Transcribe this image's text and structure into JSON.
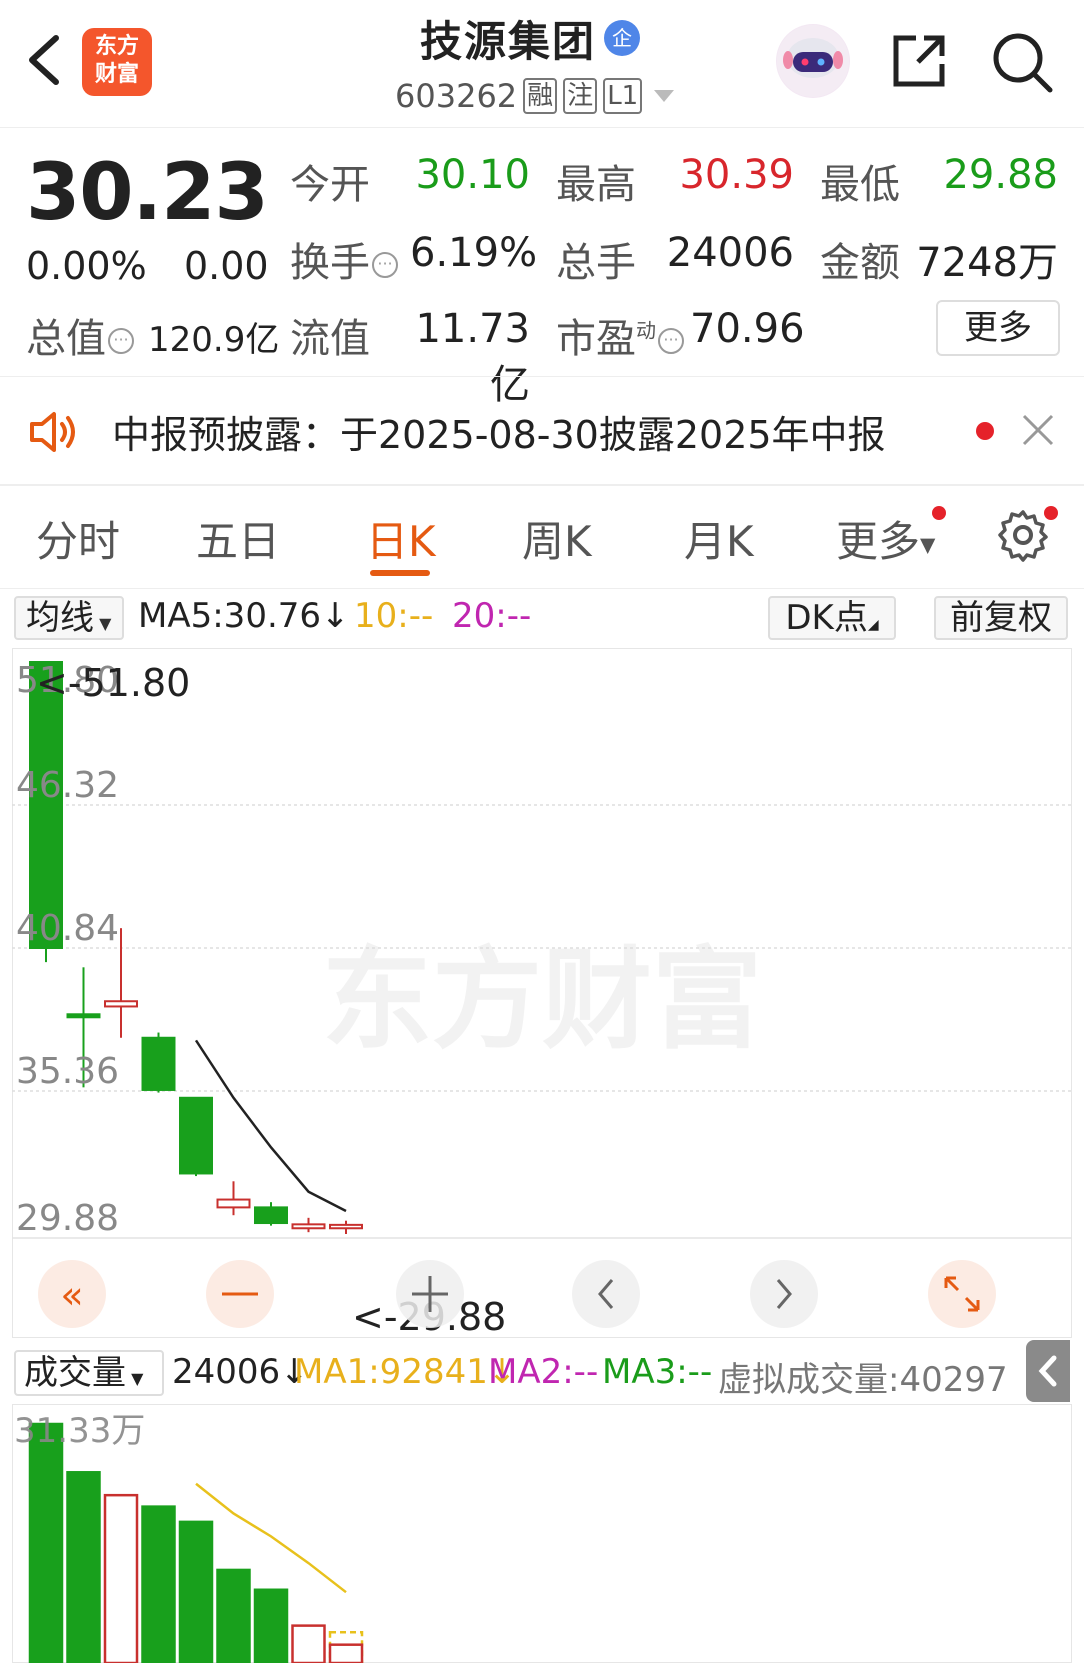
{
  "header": {
    "logo_line1": "东方",
    "logo_line2": "财富",
    "stock_name": "技源集团",
    "badge": "企",
    "stock_code": "603262",
    "tags": [
      "融",
      "注",
      "L1"
    ]
  },
  "quote": {
    "price": "30.23",
    "change_pct": "0.00%",
    "change": "0.00",
    "rows": [
      [
        {
          "label": "今开",
          "value": "30.10",
          "color": "green"
        },
        {
          "label": "最高",
          "value": "30.39",
          "color": "red"
        },
        {
          "label": "最低",
          "value": "29.88",
          "color": "green"
        }
      ],
      [
        {
          "label": "换手",
          "value": "6.19%",
          "color": "black",
          "info": true
        },
        {
          "label": "总手",
          "value": "24006",
          "color": "black"
        },
        {
          "label": "金额",
          "value": "7248万",
          "color": "black"
        }
      ]
    ],
    "total_value_label": "总值",
    "total_value": "120.9亿",
    "float_value_label": "流值",
    "float_value": "11.73亿",
    "pe_label": "市盈",
    "pe_super": "动",
    "pe_value": "70.96",
    "more_button": "更多"
  },
  "notice": {
    "text": "中报预披露：于2025-08-30披露2025年中报"
  },
  "tabs": [
    "分时",
    "五日",
    "日K",
    "周K",
    "月K",
    "更多"
  ],
  "active_tab": "日K",
  "chart_toolbar": {
    "indicator": "均线",
    "ma5": "MA5:30.76↓",
    "ma10": "10:--",
    "ma20": "20:--",
    "dk_button": "DK点",
    "adjust_button": "前复权"
  },
  "chart_data": [
    {
      "type": "candlestick",
      "y_ticks": [
        "51.80",
        "46.32",
        "40.84",
        "35.36",
        "29.88"
      ],
      "ylim": [
        29.88,
        51.8
      ],
      "max_label": "<-51.80",
      "min_label": "<-29.88",
      "watermark": "东方财富",
      "candles": [
        {
          "open": 40.84,
          "close": 51.8,
          "high": 51.8,
          "low": 40.3,
          "color": "green"
        },
        {
          "open": 38.3,
          "close": 38.3,
          "high": 40.1,
          "low": 35.5,
          "color": "green"
        },
        {
          "open": 38.8,
          "close": 38.6,
          "high": 41.6,
          "low": 37.4,
          "color": "red"
        },
        {
          "open": 35.4,
          "close": 37.4,
          "high": 37.6,
          "low": 35.3,
          "color": "green"
        },
        {
          "open": 32.2,
          "close": 35.1,
          "high": 35.1,
          "low": 32.1,
          "color": "green"
        },
        {
          "open": 30.9,
          "close": 31.2,
          "high": 31.9,
          "low": 30.6,
          "color": "red"
        },
        {
          "open": 30.3,
          "close": 30.9,
          "high": 31.1,
          "low": 30.2,
          "color": "green"
        },
        {
          "open": 30.1,
          "close": 30.25,
          "high": 30.5,
          "low": 29.95,
          "color": "red"
        },
        {
          "open": 30.1,
          "close": 30.23,
          "high": 30.39,
          "low": 29.88,
          "color": "red"
        }
      ],
      "ma5": [
        null,
        null,
        null,
        null,
        37.3,
        35.1,
        33.2,
        31.5,
        30.76
      ]
    },
    {
      "type": "bar",
      "title": "成交量",
      "y_tick": "31.33万",
      "volume_value": "24006↓",
      "ma1": "MA1:92841↓",
      "ma2": "MA2:--",
      "ma3": "MA3:--",
      "virtual": "虚拟成交量:40297",
      "bars": [
        {
          "value": 313300,
          "color": "green"
        },
        {
          "value": 250000,
          "color": "green"
        },
        {
          "value": 220000,
          "color": "red"
        },
        {
          "value": 205000,
          "color": "green"
        },
        {
          "value": 185000,
          "color": "green"
        },
        {
          "value": 122000,
          "color": "green"
        },
        {
          "value": 96000,
          "color": "green"
        },
        {
          "value": 49000,
          "color": "red"
        },
        {
          "value": 24006,
          "color": "red",
          "virtual": 40297
        }
      ],
      "ma1_series": [
        null,
        null,
        null,
        null,
        235000,
        196000,
        166000,
        131000,
        92841
      ]
    }
  ],
  "colors": {
    "up": "#c8302e",
    "down": "#18a01c",
    "accent": "#e55a12",
    "ma5": "#222222",
    "ma10": "#e8b01c",
    "ma20": "#c026b0",
    "vol_ma1": "#e8c11c",
    "vol_ma2": "#c026b0",
    "vol_ma3": "#1a9c1a"
  }
}
